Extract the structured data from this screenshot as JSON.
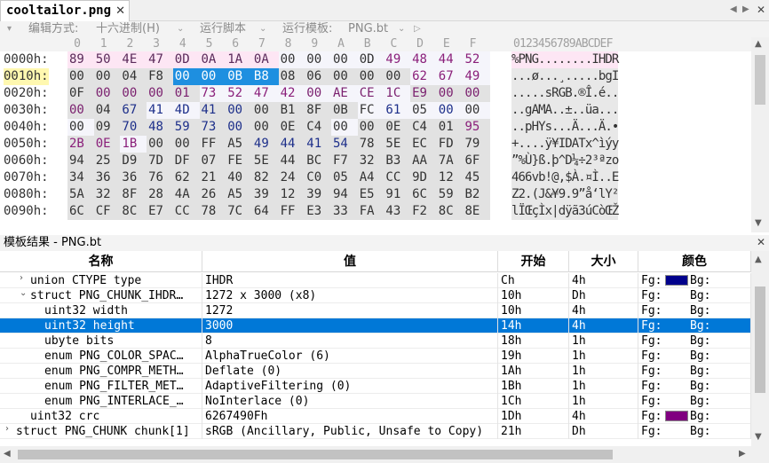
{
  "tab": {
    "filename": "cooltailor.png",
    "close": "✕"
  },
  "toolbar": {
    "edit_mode_label": "编辑方式:",
    "edit_mode_value": "十六进制(H)",
    "run_script": "运行脚本",
    "run_template_label": "运行模板:",
    "run_template_value": "PNG.bt"
  },
  "hex": {
    "columns": [
      "0",
      "1",
      "2",
      "3",
      "4",
      "5",
      "6",
      "7",
      "8",
      "9",
      "A",
      "B",
      "C",
      "D",
      "E",
      "F"
    ],
    "ascii_header": "0123456789ABCDEF",
    "rows": [
      {
        "addr": "0000h:",
        "bytes": [
          "89",
          "50",
          "4E",
          "47",
          "0D",
          "0A",
          "1A",
          "0A",
          "00",
          "00",
          "00",
          "0D",
          "49",
          "48",
          "44",
          "52"
        ],
        "ascii": "%PNG........IHDR"
      },
      {
        "addr": "0010h:",
        "bytes": [
          "00",
          "00",
          "04",
          "F8",
          "00",
          "00",
          "0B",
          "B8",
          "08",
          "06",
          "00",
          "00",
          "00",
          "62",
          "67",
          "49"
        ],
        "ascii": "...ø...¸.....bgI"
      },
      {
        "addr": "0020h:",
        "bytes": [
          "0F",
          "00",
          "00",
          "00",
          "01",
          "73",
          "52",
          "47",
          "42",
          "00",
          "AE",
          "CE",
          "1C",
          "E9",
          "00",
          "00"
        ],
        "ascii": ".....sRGB.®Î.é.."
      },
      {
        "addr": "0030h:",
        "bytes": [
          "00",
          "04",
          "67",
          "41",
          "4D",
          "41",
          "00",
          "00",
          "B1",
          "8F",
          "0B",
          "FC",
          "61",
          "05",
          "00",
          "00"
        ],
        "ascii": "..gAMA..±..üa..."
      },
      {
        "addr": "0040h:",
        "bytes": [
          "00",
          "09",
          "70",
          "48",
          "59",
          "73",
          "00",
          "00",
          "0E",
          "C4",
          "00",
          "00",
          "0E",
          "C4",
          "01",
          "95"
        ],
        "ascii": "..pHYs...Ä...Ä.•"
      },
      {
        "addr": "0050h:",
        "bytes": [
          "2B",
          "0E",
          "1B",
          "00",
          "00",
          "FF",
          "A5",
          "49",
          "44",
          "41",
          "54",
          "78",
          "5E",
          "EC",
          "FD",
          "79"
        ],
        "ascii": "+....ÿ¥IDATx^ìýy"
      },
      {
        "addr": "0060h:",
        "bytes": [
          "94",
          "25",
          "D9",
          "7D",
          "DF",
          "07",
          "FE",
          "5E",
          "44",
          "BC",
          "F7",
          "32",
          "B3",
          "AA",
          "7A",
          "6F"
        ],
        "ascii": "”%Ù}ß.þ^D¼÷2³ªzo"
      },
      {
        "addr": "0070h:",
        "bytes": [
          "34",
          "36",
          "36",
          "76",
          "62",
          "21",
          "40",
          "82",
          "24",
          "C0",
          "05",
          "A4",
          "CC",
          "9D",
          "12",
          "45"
        ],
        "ascii": "466vb!@‚$À.¤Ì..E"
      },
      {
        "addr": "0080h:",
        "bytes": [
          "5A",
          "32",
          "8F",
          "28",
          "4A",
          "26",
          "A5",
          "39",
          "12",
          "39",
          "94",
          "E5",
          "91",
          "6C",
          "59",
          "B2"
        ],
        "ascii": "Z2.(J&¥9.9”å‘lY²"
      },
      {
        "addr": "0090h:",
        "bytes": [
          "6C",
          "CF",
          "8C",
          "E7",
          "CC",
          "78",
          "7C",
          "64",
          "FF",
          "E3",
          "33",
          "FA",
          "43",
          "F2",
          "8C",
          "8E"
        ],
        "ascii": "lÏŒçÌx|dÿã3úCòŒŽ"
      }
    ]
  },
  "results": {
    "title": "模板结果 - PNG.bt",
    "close": "✕",
    "headers": {
      "name": "名称",
      "value": "值",
      "start": "开始",
      "size": "大小",
      "color": "颜色"
    },
    "rows": [
      {
        "name": "union CTYPE type",
        "value": "IHDR",
        "start": "Ch",
        "size": "4h",
        "fg": "Fg:",
        "bg": "Bg:",
        "twisty": "›",
        "indent": 1,
        "swatch": "#00008b"
      },
      {
        "name": "struct PNG_CHUNK_IHDR…",
        "value": "1272 x 3000 (x8)",
        "start": "10h",
        "size": "Dh",
        "fg": "Fg:",
        "bg": "Bg:",
        "twisty": "⌄",
        "indent": 1
      },
      {
        "name": "uint32 width",
        "value": "1272",
        "start": "10h",
        "size": "4h",
        "fg": "Fg:",
        "bg": "Bg:",
        "indent": 2
      },
      {
        "name": "uint32 height",
        "value": "3000",
        "start": "14h",
        "size": "4h",
        "fg": "Fg:",
        "bg": "Bg:",
        "indent": 2,
        "selected": true
      },
      {
        "name": "ubyte bits",
        "value": "8",
        "start": "18h",
        "size": "1h",
        "fg": "Fg:",
        "bg": "Bg:",
        "indent": 2
      },
      {
        "name": "enum PNG_COLOR_SPAC…",
        "value": "AlphaTrueColor (6)",
        "start": "19h",
        "size": "1h",
        "fg": "Fg:",
        "bg": "Bg:",
        "indent": 2
      },
      {
        "name": "enum PNG_COMPR_METH…",
        "value": "Deflate (0)",
        "start": "1Ah",
        "size": "1h",
        "fg": "Fg:",
        "bg": "Bg:",
        "indent": 2
      },
      {
        "name": "enum PNG_FILTER_MET…",
        "value": "AdaptiveFiltering (0)",
        "start": "1Bh",
        "size": "1h",
        "fg": "Fg:",
        "bg": "Bg:",
        "indent": 2
      },
      {
        "name": "enum PNG_INTERLACE_…",
        "value": "NoInterlace (0)",
        "start": "1Ch",
        "size": "1h",
        "fg": "Fg:",
        "bg": "Bg:",
        "indent": 2
      },
      {
        "name": "uint32 crc",
        "value": "6267490Fh",
        "start": "1Dh",
        "size": "4h",
        "fg": "Fg:",
        "bg": "Bg:",
        "indent": 1,
        "swatch": "#800080"
      },
      {
        "name": "struct PNG_CHUNK chunk[1]",
        "value": "sRGB  (Ancillary, Public, Unsafe to Copy)",
        "start": "21h",
        "size": "Dh",
        "fg": "Fg:",
        "bg": "Bg:",
        "twisty": "›",
        "indent": 0
      }
    ]
  }
}
